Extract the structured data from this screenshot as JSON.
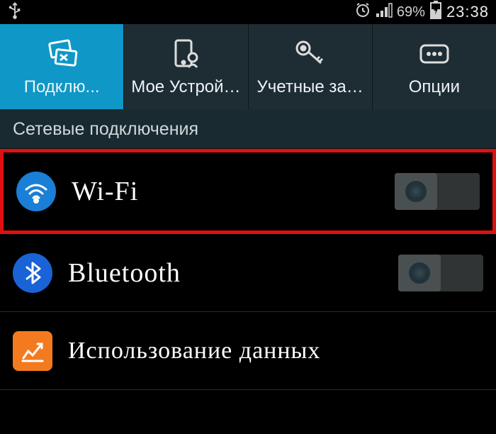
{
  "status": {
    "battery_percent": "69%",
    "time": "23:38"
  },
  "tabs": [
    {
      "label": "Подклю...",
      "active": true
    },
    {
      "label": "Мое Устрой…"
    },
    {
      "label": "Учетные за…"
    },
    {
      "label": "Опции"
    }
  ],
  "section_header": "Сетевые подключения",
  "items": [
    {
      "label": "Wi-Fi",
      "toggle": true,
      "toggle_on": false,
      "highlighted": true
    },
    {
      "label": "Bluetooth",
      "toggle": true,
      "toggle_on": false
    },
    {
      "label": "Использование данных",
      "toggle": false
    }
  ]
}
